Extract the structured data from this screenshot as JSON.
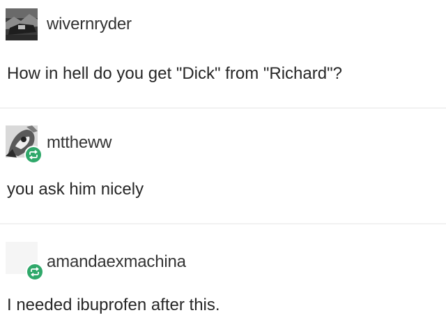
{
  "posts": [
    {
      "username": "wivernryder",
      "text": "How in hell do you get \"Dick\" from \"Richard\"?",
      "avatar_icon": "landscape-avatar-icon",
      "reblog_icon": null
    },
    {
      "username": "mttheww",
      "text": "you ask him nicely",
      "avatar_icon": "sketch-avatar-icon",
      "reblog_icon": "reblog-icon"
    },
    {
      "username": "amandaexmachina",
      "text": "I needed ibuprofen after this.",
      "avatar_icon": "blank-avatar-icon",
      "reblog_icon": "reblog-icon"
    }
  ],
  "colors": {
    "reblog_badge": "#2fa86a",
    "divider": "#f1f1f1",
    "text": "#262626"
  }
}
